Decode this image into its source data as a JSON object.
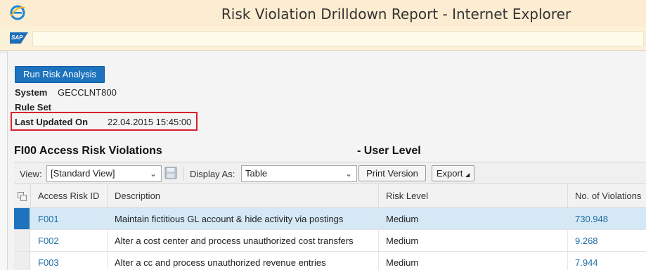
{
  "window": {
    "title": "Risk Violation Drilldown Report - Internet Explorer",
    "browser_icon": "ie-icon"
  },
  "sap": {
    "logo_text": "SAP"
  },
  "actions": {
    "run_label": "Run Risk Analysis"
  },
  "info": {
    "system_label": "System",
    "system_value": "GECCLNT800",
    "ruleset_label": "Rule Set",
    "updated_label": "Last Updated On",
    "updated_value": "22.04.2015 15:45:00"
  },
  "section": {
    "title": "FI00 Access Risk Violations",
    "suffix": "- User Level"
  },
  "toolbar": {
    "view_label": "View:",
    "view_value": "[Standard View]",
    "display_label": "Display As:",
    "display_value": "Table",
    "print_label": "Print Version",
    "export_label": "Export"
  },
  "table": {
    "columns": [
      "Access Risk ID",
      "Description",
      "Risk Level",
      "No. of Violations"
    ],
    "rows": [
      {
        "id": "F001",
        "description": "Maintain fictitious GL account & hide activity via postings",
        "level": "Medium",
        "count": "730.948",
        "selected": true
      },
      {
        "id": "F002",
        "description": "Alter a cost center and process unauthorized cost transfers",
        "level": "Medium",
        "count": "9.268",
        "selected": false
      },
      {
        "id": "F003",
        "description": "Alter a cc and process unauthorized revenue entries",
        "level": "Medium",
        "count": "7.944",
        "selected": false
      }
    ]
  },
  "colors": {
    "accent": "#1e73be",
    "selected_row": "#d5e8f6",
    "highlight_border": "#d8202a",
    "titlebar": "#fcecd2"
  }
}
